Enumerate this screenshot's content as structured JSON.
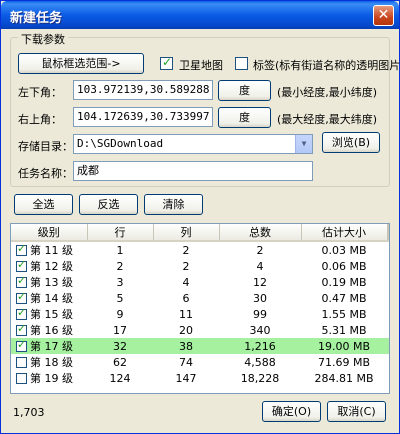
{
  "window": {
    "title": "新建任务",
    "close": "✕"
  },
  "params": {
    "group_title": "下载参数",
    "select_btn": "鼠标框选范围->",
    "satellite_label": "卫星地图",
    "satellite_checked": true,
    "tag_label": "标签(标有街道名称的透明图片)",
    "tag_checked": false,
    "lower_left_label": "左下角：",
    "lower_left_value": "103.972139,30.589288",
    "lower_left_btn": "度",
    "lower_left_hint": "(最小经度,最小纬度)",
    "upper_right_label": "右上角：",
    "upper_right_value": "104.172639,30.733997",
    "upper_right_btn": "度",
    "upper_right_hint": "(最大经度,最大纬度)",
    "dir_label": "存储目录：",
    "dir_value": "D:\\SGDownload",
    "browse_btn": "浏览(B)",
    "name_label": "任务名称：",
    "name_value": "成都"
  },
  "actions": {
    "select_all": "全选",
    "invert": "反选",
    "clear": "清除"
  },
  "table": {
    "headers": [
      "级别",
      "行",
      "列",
      "总数",
      "估计大小"
    ],
    "rows": [
      {
        "level": "第 11 级",
        "rows": "1",
        "cols": "2",
        "total": "2",
        "size": "0.03 MB",
        "checked": true
      },
      {
        "level": "第 12 级",
        "rows": "2",
        "cols": "2",
        "total": "4",
        "size": "0.06 MB",
        "checked": true
      },
      {
        "level": "第 13 级",
        "rows": "3",
        "cols": "4",
        "total": "12",
        "size": "0.19 MB",
        "checked": true
      },
      {
        "level": "第 14 级",
        "rows": "5",
        "cols": "6",
        "total": "30",
        "size": "0.47 MB",
        "checked": true
      },
      {
        "level": "第 15 级",
        "rows": "9",
        "cols": "11",
        "total": "99",
        "size": "1.55 MB",
        "checked": true
      },
      {
        "level": "第 16 级",
        "rows": "17",
        "cols": "20",
        "total": "340",
        "size": "5.31 MB",
        "checked": true
      },
      {
        "level": "第 17 级",
        "rows": "32",
        "cols": "38",
        "total": "1,216",
        "size": "19.00 MB",
        "checked": true
      },
      {
        "level": "第 18 级",
        "rows": "62",
        "cols": "74",
        "total": "4,588",
        "size": "71.69 MB",
        "checked": false
      },
      {
        "level": "第 19 级",
        "rows": "124",
        "cols": "147",
        "total": "18,228",
        "size": "284.81 MB",
        "checked": false
      }
    ]
  },
  "status": {
    "count": "1,703"
  },
  "footer": {
    "ok": "确定(O)",
    "cancel": "取消(C)"
  }
}
